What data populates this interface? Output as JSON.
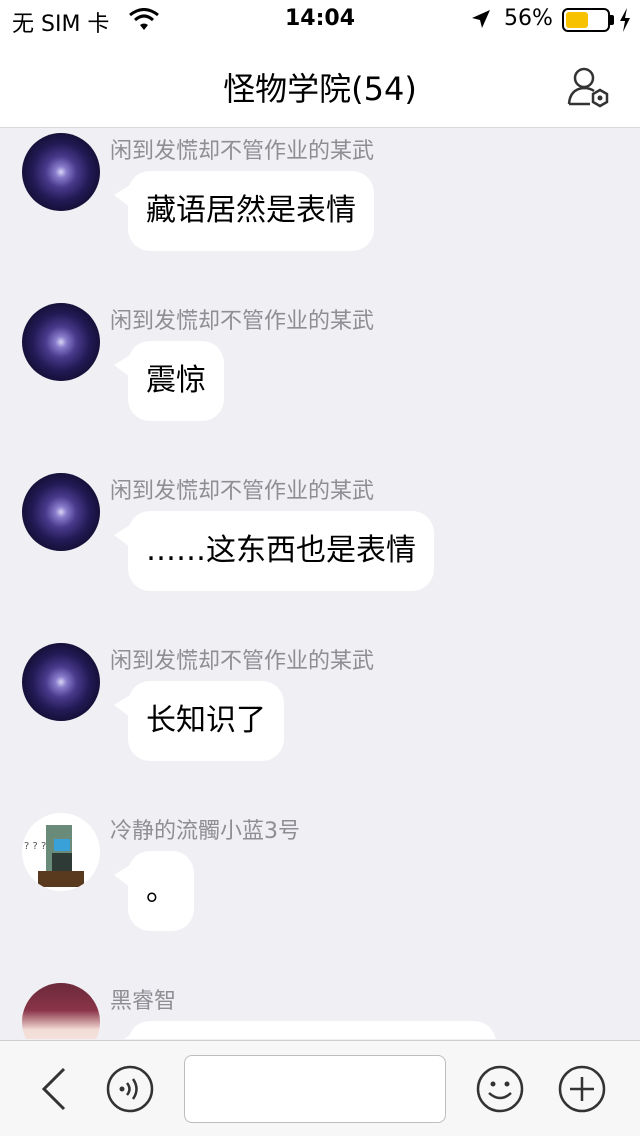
{
  "status_bar": {
    "carrier": "无 SIM 卡",
    "time": "14:04",
    "battery_percent": "56%",
    "battery_level": 0.56,
    "battery_color": "#f7c200"
  },
  "nav": {
    "title": "怪物学院(54)",
    "settings_icon": "group-settings-icon"
  },
  "messages": [
    {
      "sender": "闲到发慌却不管作业的某武",
      "text": "藏语居然是表情",
      "avatar": "galaxy-avatar"
    },
    {
      "sender": "闲到发慌却不管作业的某武",
      "text": "震惊",
      "avatar": "galaxy-avatar"
    },
    {
      "sender": "闲到发慌却不管作业的某武",
      "text": "……这东西也是表情",
      "avatar": "galaxy-avatar"
    },
    {
      "sender": "闲到发慌却不管作业的某武",
      "text": "长知识了",
      "avatar": "galaxy-avatar"
    },
    {
      "sender": "冷静的流髑小蓝3号",
      "text": "。",
      "avatar": "pixel-avatar"
    },
    {
      "sender": "黑睿智",
      "text": "",
      "avatar": "anime-avatar"
    }
  ],
  "input_bar": {
    "placeholder": "",
    "icons": [
      "back-icon",
      "voice-icon",
      "emoji-icon",
      "plus-icon"
    ]
  }
}
